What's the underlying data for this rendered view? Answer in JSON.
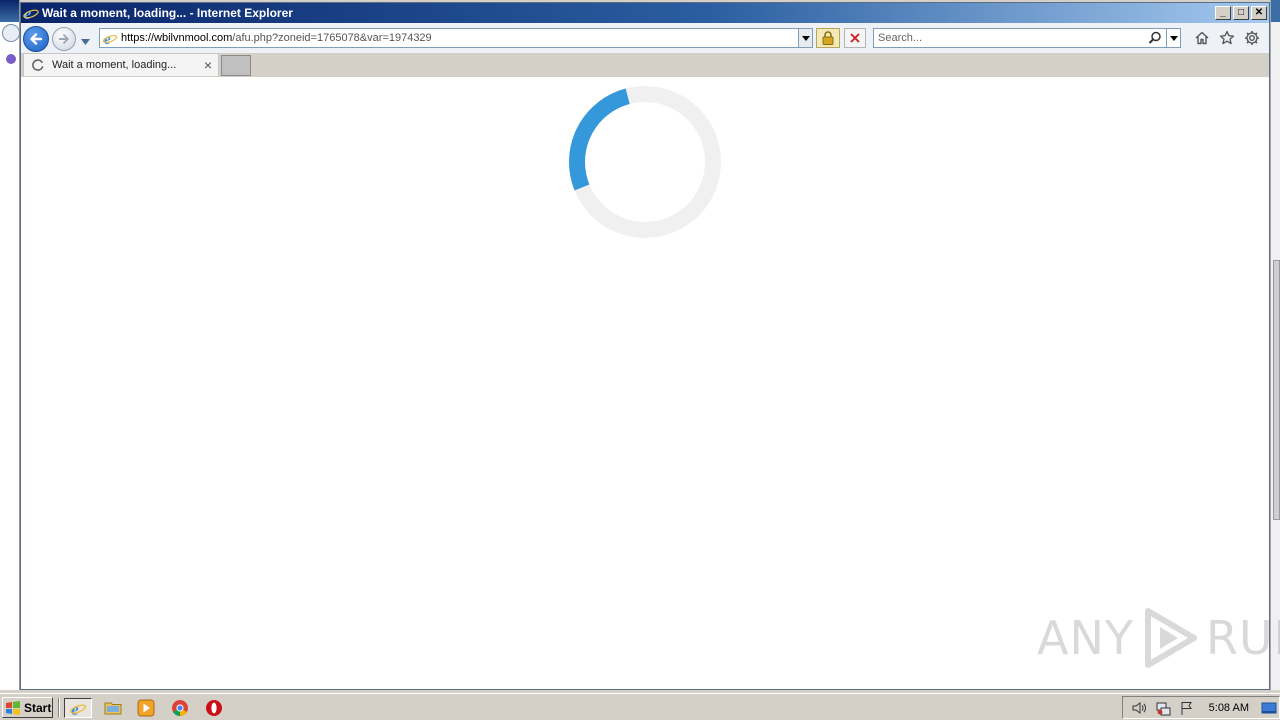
{
  "window": {
    "title": "Wait a moment, loading... - Internet Explorer",
    "controls": {
      "minimize": "_",
      "maximize": "□",
      "close": "✕"
    }
  },
  "address_bar": {
    "url_domain": "https://wbilvnmool.com",
    "url_path": "/afu.php?zoneid=1765078&var=1974329"
  },
  "search": {
    "placeholder": "Search..."
  },
  "tabs": [
    {
      "label": "Wait a moment, loading...",
      "close": "×"
    }
  ],
  "page": {
    "spinner": {
      "progress_fraction": 0.27,
      "track_color": "#f0f0f0",
      "arc_color": "#3498db"
    }
  },
  "watermark": {
    "left": "ANY",
    "right": "RUN"
  },
  "taskbar": {
    "start_label": "Start",
    "clock": "5:08 AM",
    "pinned": [
      "internet-explorer-icon",
      "folder-icon",
      "media-player-icon",
      "chrome-icon",
      "opera-icon"
    ]
  },
  "icons": {
    "back": "back-arrow-icon",
    "forward": "forward-arrow-icon",
    "home": "home-icon",
    "favorites": "star-icon",
    "tools": "gear-icon"
  }
}
